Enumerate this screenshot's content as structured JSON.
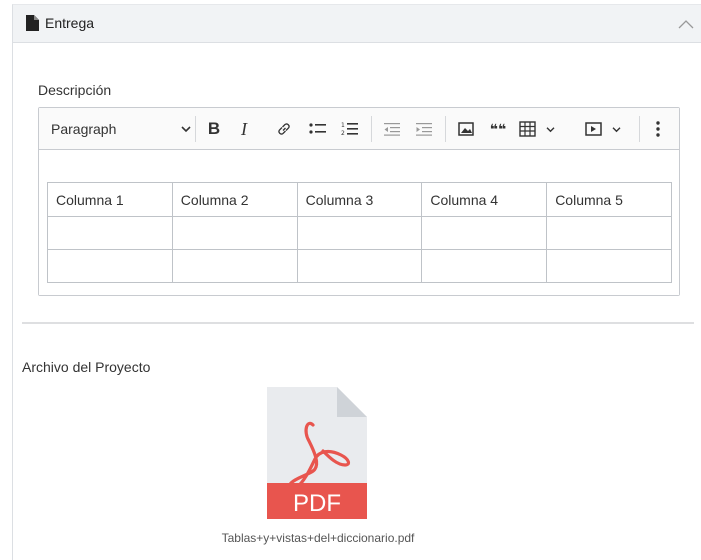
{
  "panel": {
    "title": "Entrega",
    "icons": {
      "document": "document-icon",
      "collapse": "chevron-up-icon"
    }
  },
  "description": {
    "label": "Descripción",
    "toolbar": {
      "heading_select": "Paragraph",
      "bold": "B",
      "italic": "I",
      "quote": "❝❝",
      "icons": [
        "chevron-down-icon",
        "bold-icon",
        "italic-icon",
        "link-icon",
        "bulleted-list-icon",
        "numbered-list-icon",
        "outdent-icon",
        "indent-icon",
        "image-icon",
        "quote-icon",
        "table-icon",
        "media-icon",
        "more-options-icon"
      ]
    },
    "table": {
      "rows": [
        [
          "Columna 1",
          "Columna 2",
          "Columna 3",
          "Columna 4",
          "Columna 5"
        ],
        [
          "",
          "",
          "",
          "",
          ""
        ],
        [
          "",
          "",
          "",
          "",
          ""
        ]
      ]
    }
  },
  "archivo": {
    "label": "Archivo del Proyecto",
    "file_badge": "PDF",
    "file_name": "Tablas+y+vistas+del+diccionario.pdf"
  },
  "colors": {
    "pdf_red": "#e8554e",
    "pdf_body": "#e9ebee",
    "pdf_fold": "#cfd3d8"
  }
}
